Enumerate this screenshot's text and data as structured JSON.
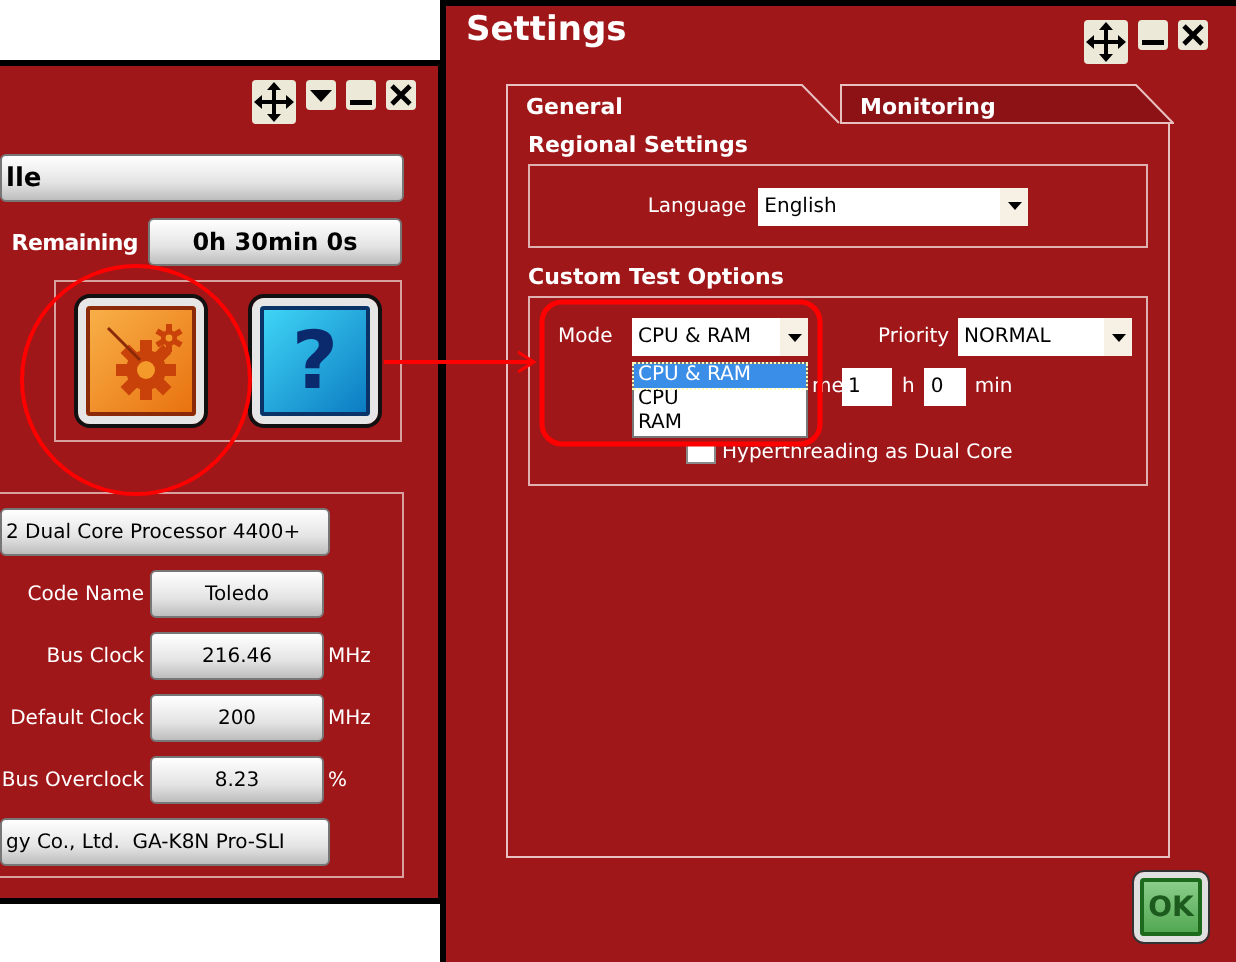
{
  "left_window": {
    "name_field": "lle",
    "remaining": {
      "label": "Remaining",
      "value": "0h 30min 0s"
    },
    "help_button": "?",
    "processor_field": "2 Dual Core Processor 4400+",
    "details": [
      {
        "label": "Code Name",
        "value": "Toledo"
      },
      {
        "label": "Bus Clock",
        "value": "216.46",
        "unit": "MHz"
      },
      {
        "label": "Default Clock",
        "value": "200",
        "unit": "MHz"
      },
      {
        "label": "Bus Overclock",
        "value": "8.23",
        "unit": "%"
      }
    ],
    "motherboard_field": "gy Co., Ltd.  GA-K8N Pro-SLI"
  },
  "settings_window": {
    "title": "Settings",
    "tabs": [
      {
        "label": "General",
        "selected": true
      },
      {
        "label": "Monitoring",
        "selected": false
      }
    ],
    "regional": {
      "heading": "Regional Settings",
      "language_label": "Language",
      "language_value": "English"
    },
    "custom": {
      "heading": "Custom Test Options",
      "mode": {
        "label": "Mode",
        "value": "CPU & RAM",
        "options": [
          {
            "label": "CPU & RAM",
            "selected": true
          },
          {
            "label": "CPU",
            "selected": false
          },
          {
            "label": "RAM",
            "selected": false
          }
        ]
      },
      "priority": {
        "label": "Priority",
        "value": "NORMAL"
      },
      "time": {
        "label": "me",
        "hours": "1",
        "hours_unit": "h",
        "minutes": "0",
        "minutes_unit": "min"
      },
      "hyperthreading": {
        "label": "Hyperthreading as Dual Core",
        "checked": false
      }
    },
    "ok_button": "OK"
  }
}
